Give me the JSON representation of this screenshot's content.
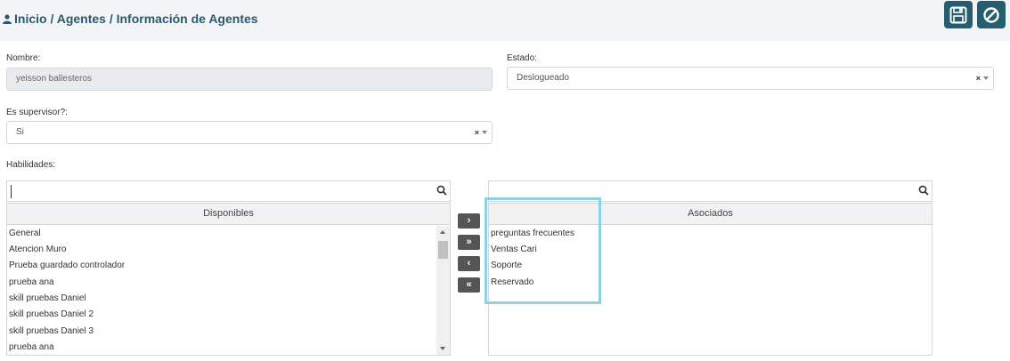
{
  "header": {
    "breadcrumb": "Inicio / Agentes / Información de Agentes",
    "icons": {
      "user": "user-icon",
      "save": "save-icon",
      "cancel": "cancel-icon"
    },
    "button_color": "#255e6f"
  },
  "form": {
    "nombre": {
      "label": "Nombre:",
      "value": "yeisson ballesteros"
    },
    "estado": {
      "label": "Estado:",
      "value": "Deslogueado",
      "clear": "×"
    },
    "supervisor": {
      "label": "Es supervisor?:",
      "value": "Si",
      "clear": "×"
    },
    "habilidades_label": "Habilidades:"
  },
  "dual_list": {
    "available": {
      "title": "Disponibles",
      "items": [
        "General",
        "Atencion Muro",
        "Prueba guardado controlador",
        "prueba ana",
        "skill pruebas Daniel",
        "skill pruebas Daniel 2",
        "skill pruebas Daniel 3",
        "prueba ana"
      ]
    },
    "associated": {
      "title": "Asociados",
      "items": [
        "preguntas frecuentes",
        "Ventas Cari",
        "Soporte",
        "Reservado"
      ]
    },
    "buttons": {
      "move_one": "›",
      "move_all": "»",
      "remove_one": "‹",
      "remove_all": "«"
    }
  },
  "highlight_color": "#8fd1e2"
}
